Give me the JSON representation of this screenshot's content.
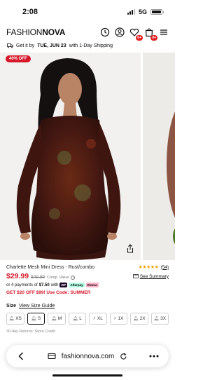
{
  "status_bar": {
    "time": "2:08",
    "network": "5G"
  },
  "header": {
    "logo_part1": "FASHION",
    "logo_part2": "NOVA",
    "wishlist_count": "0+",
    "cart_count": "0+"
  },
  "shipping": {
    "prefix": "Get it by",
    "date": "TUE, JUN 23",
    "suffix": "with 1-Day Shipping"
  },
  "gallery": {
    "discount_badge": "40% OFF"
  },
  "product": {
    "name": "Charlette Mesh Mini Dress - Rust/combo",
    "rating_stars": "★★★★★",
    "review_count": "(54)",
    "price": "$29.99",
    "compare_price": "$49.99",
    "compare_label": "Comp. Value",
    "size_summary": "See Summary",
    "installments_prefix": "or 4 payments of",
    "installment_amount": "$7.50",
    "installments_with": "with",
    "pay_options": [
      "ZIP",
      "Afterpay",
      "Klarna"
    ],
    "promo": "GET $20 OFF $99! Use Code: SUMMER"
  },
  "sizes": {
    "label": "Size",
    "selected": "S",
    "guide": "View Size Guide",
    "options": [
      "XS",
      "S",
      "M",
      "L",
      "XL",
      "1X",
      "2X",
      "3X"
    ]
  },
  "returns_text": "30-day Returns: Store Credit",
  "browser": {
    "url": "fashionnova.com"
  },
  "colors": {
    "accent_red": "#d5182a",
    "star": "#f2a20c"
  }
}
